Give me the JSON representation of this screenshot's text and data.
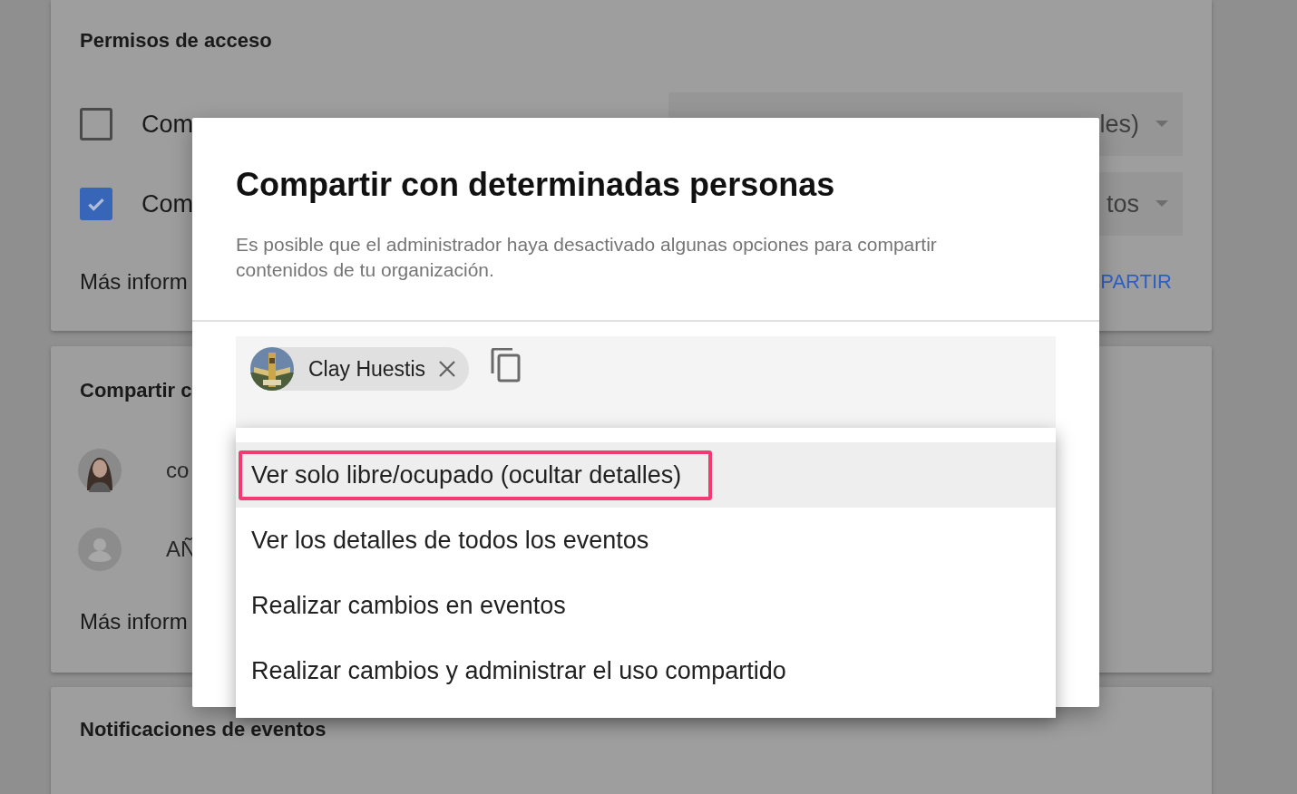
{
  "settings": {
    "access_card": {
      "title": "Permisos de acceso",
      "options": [
        {
          "label": "Com",
          "checked": false,
          "select_value": "les)"
        },
        {
          "label": "Com",
          "checked": true,
          "select_value": "tos"
        }
      ],
      "more_link": "Más inform",
      "action": "PARTIR"
    },
    "share_card": {
      "title": "Compartir c",
      "people": [
        {
          "label": "co"
        },
        {
          "kind": "placeholder",
          "label": "AÑ"
        }
      ],
      "more_link": "Más inform"
    },
    "notifications_card": {
      "title": "Notificaciones de eventos"
    }
  },
  "dialog": {
    "title": "Compartir con determinadas personas",
    "description": "Es posible que el administrador haya desactivado algunas opciones para compartir contenidos de tu organización.",
    "recipients": [
      {
        "name": "Clay Huestis"
      }
    ]
  },
  "permission_menu": {
    "options": [
      {
        "label": "Ver solo libre/ocupado (ocultar detalles)",
        "selected": true
      },
      {
        "label": "Ver los detalles de todos los eventos",
        "selected": false
      },
      {
        "label": "Realizar cambios en eventos",
        "selected": false
      },
      {
        "label": "Realizar cambios y administrar el uso compartido",
        "selected": false
      }
    ]
  }
}
